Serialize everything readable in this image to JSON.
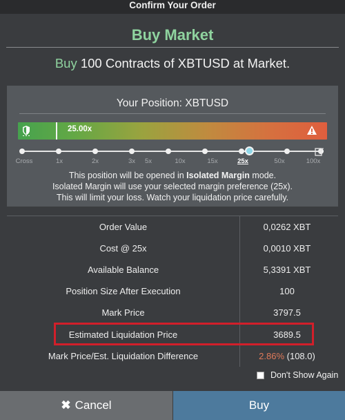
{
  "window": {
    "title": "Confirm Your Order"
  },
  "order": {
    "heading": "Buy Market",
    "summary_side": "Buy",
    "summary_rest": "100 Contracts of XBTUSD at Market."
  },
  "position": {
    "title": "Your Position: XBTUSD",
    "leverage_value": "25.00x",
    "leverage_fraction": 0.07,
    "slider_ticks": [
      "Cross",
      "1x",
      "2x",
      "3x",
      "5x",
      "10x",
      "15x",
      "25x",
      "50x",
      "100x"
    ],
    "slider_selected": "25x",
    "note_line1_pre": "This position will be opened in",
    "note_line1_bold": "Isolated Margin",
    "note_line1_post": "mode.",
    "note_line2": "Isolated Margin will use your selected margin preference (25x).",
    "note_line3": "This will limit your loss. Watch your liquidation price carefully."
  },
  "details": [
    {
      "label": "Order Value",
      "value": "0,0262 XBT"
    },
    {
      "label": "Cost @ 25x",
      "value": "0,0010 XBT"
    },
    {
      "label": "Available Balance",
      "value": "5,3391 XBT"
    },
    {
      "label": "Position Size After Execution",
      "value": "100"
    },
    {
      "label": "Mark Price",
      "value": "3797.5"
    },
    {
      "label": "Estimated Liquidation Price",
      "value": "3689.5"
    },
    {
      "label": "Mark Price/Est. Liquidation Difference",
      "value_pct": "2.86%",
      "value_rest": "(108.0)"
    }
  ],
  "dont_show_again": {
    "label": "Don't Show Again",
    "checked": false
  },
  "buttons": {
    "cancel_icon": "✖",
    "cancel": "Cancel",
    "buy": "Buy"
  },
  "colors": {
    "accent_green": "#8fd39f",
    "buy_button": "#4d7a9d",
    "cancel_button": "#6a6d70",
    "highlight_border": "#d21f2a",
    "difference_pct": "#e07a5a"
  },
  "icons": {
    "leverage_left": "shield-icon",
    "leverage_right": "warning-icon",
    "slider_edit": "edit-icon",
    "cancel": "close-icon"
  }
}
